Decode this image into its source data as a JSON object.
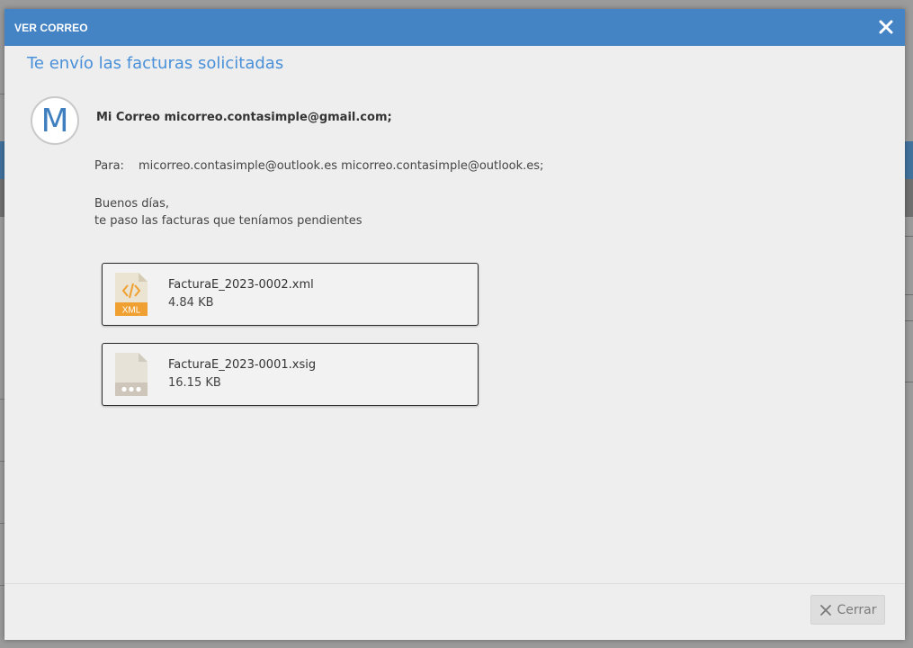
{
  "modal": {
    "title": "VER CORREO",
    "subject": "Te envío las facturas solicitadas"
  },
  "sender": {
    "avatar_letter": "M",
    "line": "Mi Correo micorreo.contasimple@gmail.com;"
  },
  "recipients": {
    "label": "Para:",
    "value": "micorreo.contasimple@outlook.es micorreo.contasimple@outlook.es;"
  },
  "message": {
    "lines": [
      "Buenos días,",
      "te paso las facturas que teníamos pendientes"
    ]
  },
  "attachments": [
    {
      "name": "FacturaE_2023-0002.xml",
      "size": "4.84 KB",
      "icon": "xml-file-icon",
      "badge": "XML"
    },
    {
      "name": "FacturaE_2023-0001.xsig",
      "size": "16.15 KB",
      "icon": "generic-file-icon"
    }
  ],
  "footer": {
    "close_label": "Cerrar"
  },
  "colors": {
    "header": "#4584c4",
    "subject": "#4a90d9",
    "avatar_letter": "#3f7fbf",
    "xml_badge": "#f0a030"
  }
}
